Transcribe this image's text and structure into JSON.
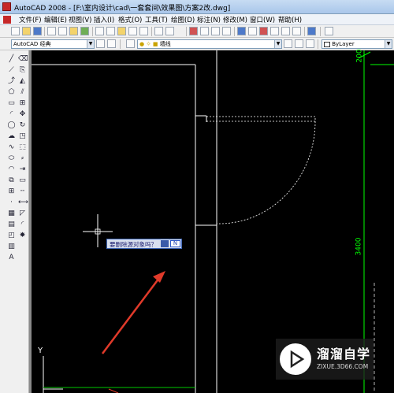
{
  "window": {
    "title": "AutoCAD 2008 - [F:\\室内设计\\cad\\一套套间\\效果图\\方案2改.dwg]"
  },
  "menu": {
    "items": [
      "文件(F)",
      "编辑(E)",
      "视图(V)",
      "插入(I)",
      "格式(O)",
      "工具(T)",
      "绘图(D)",
      "标注(N)",
      "修改(M)",
      "窗口(W)",
      "帮助(H)"
    ]
  },
  "toolbar": {
    "workspace": "AutoCAD 经典",
    "layer": "墙线",
    "linetype": "ByLayer"
  },
  "prompt": {
    "question": "要删除源对象吗？",
    "option": "N"
  },
  "drawing": {
    "dim_top": "200",
    "dim_right": "3400",
    "ucs_y": "Y"
  },
  "watermark": {
    "name": "溜溜自学",
    "url": "ZIXUE.3D66.COM"
  },
  "colors": {
    "canvas": "#000000",
    "drawing_lines": "#ffffff",
    "dimension": "#00ff00",
    "arrow": "#e03a2a"
  }
}
